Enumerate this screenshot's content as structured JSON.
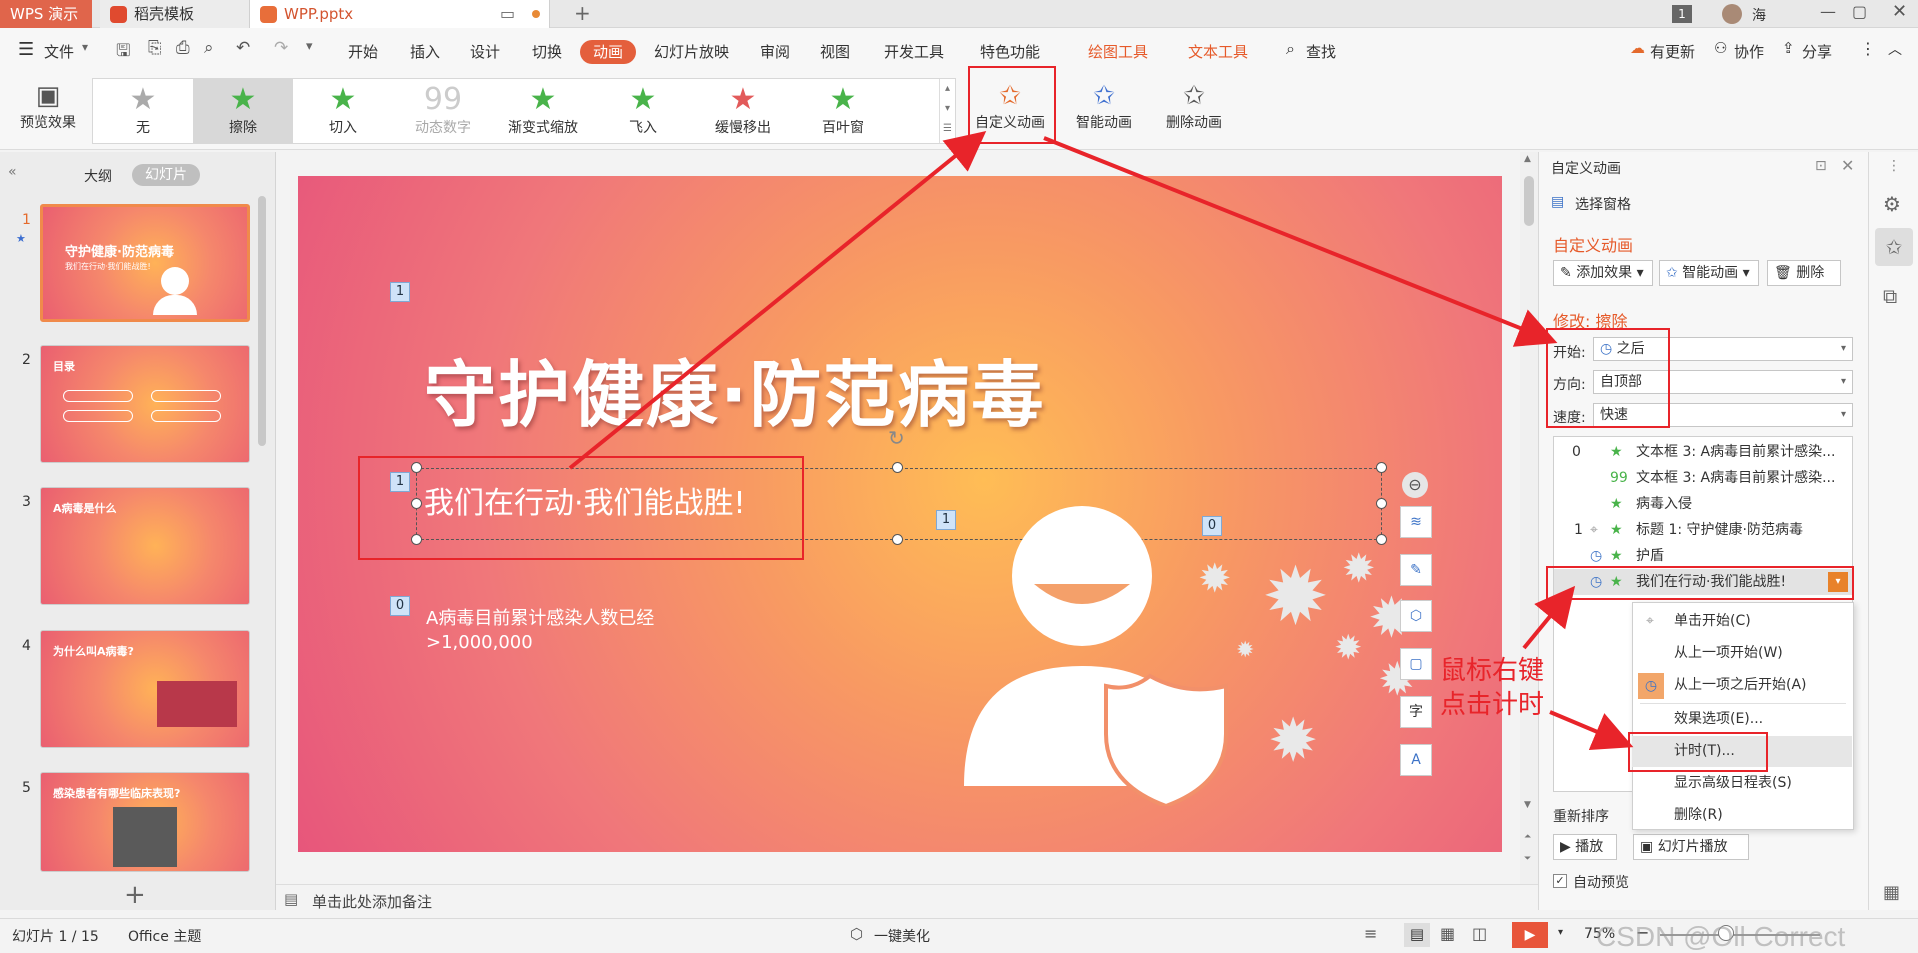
{
  "tabbar": {
    "app_tab": "WPS 演示",
    "template_tab": "稻壳模板",
    "file_tab": "WPP.pptx",
    "user_name": "海",
    "badge": "1"
  },
  "menu": {
    "file": "文件",
    "items": [
      "开始",
      "插入",
      "设计",
      "切换",
      "动画",
      "幻灯片放映",
      "审阅",
      "视图",
      "开发工具",
      "特色功能"
    ],
    "drawing_tools": "绘图工具",
    "text_tools": "文本工具",
    "search": "查找",
    "update": "有更新",
    "collab": "协作",
    "share": "分享"
  },
  "ribbon": {
    "preview": "预览效果",
    "gallery": [
      "无",
      "擦除",
      "切入",
      "动态数字",
      "渐变式缩放",
      "飞入",
      "缓慢移出",
      "百叶窗"
    ],
    "custom_anim": "自定义动画",
    "smart_anim": "智能动画",
    "delete_anim": "删除动画"
  },
  "leftpane": {
    "outline_tab": "大纲",
    "slides_tab": "幻灯片",
    "thumbs": [
      {
        "num": "1",
        "title": "守护健康·防范病毒",
        "sub": "我们在行动·我们能战胜!"
      },
      {
        "num": "2",
        "title": "目录",
        "sub": ""
      },
      {
        "num": "3",
        "title": "A病毒是什么",
        "sub": ""
      },
      {
        "num": "4",
        "title": "为什么叫A病毒?",
        "sub": ""
      },
      {
        "num": "5",
        "title": "感染患者有哪些临床表现?",
        "sub": ""
      }
    ]
  },
  "slide": {
    "title": "守护健康·防范病毒",
    "subtitle": "我们在行动·我们能战胜!",
    "body_line1": "A病毒目前累计感染人数已经",
    "body_line2": ">1,000,000",
    "tags": {
      "t1": "1",
      "t2": "1",
      "t3": "1",
      "t4": "0",
      "t5": "0"
    }
  },
  "notes": {
    "placeholder": "单击此处添加备注"
  },
  "rightpane": {
    "header": "自定义动画",
    "selection_pane": "选择窗格",
    "section_title": "自定义动画",
    "add_effect": "添加效果",
    "smart_anim": "智能动画",
    "delete": "删除",
    "modify_label": "修改: 擦除",
    "start_label": "开始:",
    "start_value": "之后",
    "direction_label": "方向:",
    "direction_value": "自顶部",
    "speed_label": "速度:",
    "speed_value": "快速",
    "list": [
      {
        "num": "0",
        "text": "文本框 3: A病毒目前累计感染..."
      },
      {
        "num": "",
        "text": "文本框 3: A病毒目前累计感染..."
      },
      {
        "num": "",
        "text": "病毒入侵"
      },
      {
        "num": "1",
        "text": "标题 1: 守护健康·防范病毒"
      },
      {
        "num": "",
        "text": "护盾"
      },
      {
        "num": "",
        "text": "我们在行动·我们能战胜!"
      }
    ],
    "reorder": "重新排序",
    "play": "播放",
    "slideshow": "幻灯片播放",
    "auto_preview": "自动预览"
  },
  "context_menu": [
    "单击开始(C)",
    "从上一项开始(W)",
    "从上一项之后开始(A)",
    "效果选项(E)...",
    "计时(T)...",
    "显示高级日程表(S)",
    "删除(R)"
  ],
  "annotation": {
    "line1": "鼠标右键",
    "line2": "点击计时"
  },
  "statusbar": {
    "slide_pos": "幻灯片 1 / 15",
    "theme": "Office 主题",
    "beautify": "一键美化",
    "zoom": "75%",
    "watermark": "CSDN @Oll Correct"
  },
  "colors": {
    "accent": "#e45f3c",
    "annotation_red": "#e8242a"
  }
}
